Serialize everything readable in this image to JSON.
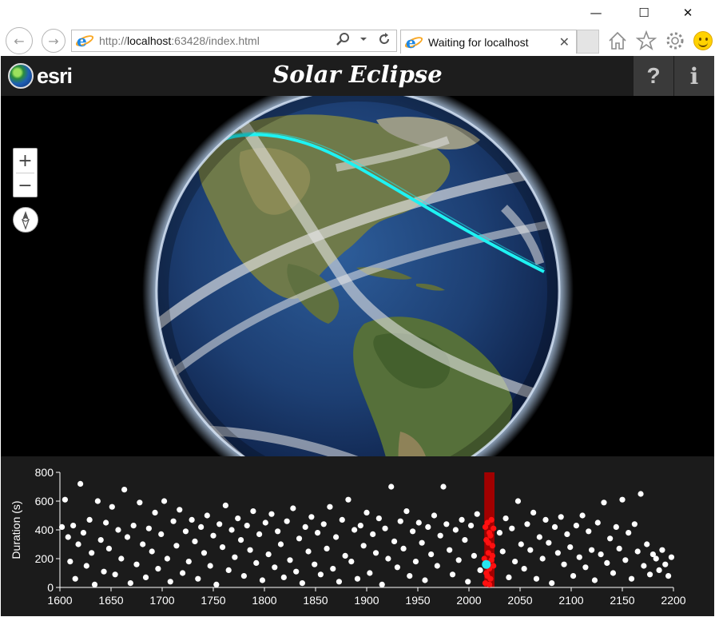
{
  "window": {
    "minimize_glyph": "—",
    "maximize_glyph": "☐",
    "close_glyph": "✕"
  },
  "browser": {
    "url_prefix": "http://",
    "url_host": "localhost",
    "url_rest": ":63428/index.html",
    "tab_label": "Waiting for localhost",
    "tab_close": "✕",
    "back_glyph": "←",
    "forward_glyph": "→",
    "icons": [
      "back-icon",
      "forward-icon",
      "ie-icon",
      "search-icon",
      "dropdown-icon",
      "refresh-icon",
      "home-icon",
      "favorites-star-icon",
      "settings-gear-icon",
      "smiley-feedback-icon"
    ]
  },
  "app": {
    "logo_text": "esri",
    "title": "Solar Eclipse",
    "help_label": "?",
    "info_label": "i",
    "zoom_in": "+",
    "zoom_out": "−"
  },
  "colors": {
    "header_bg": "#1d1d1d",
    "chart_bg": "#1b1b1b",
    "eclipse_path": "#1ef2f2",
    "selected_band": "#a10000",
    "highlight_points": "#ff1010",
    "points": "#ffffff",
    "selected_point": "#27e6f0"
  },
  "chart_data": {
    "type": "scatter",
    "xlabel": "",
    "ylabel": "Duration (s)",
    "xlim": [
      1600,
      2200
    ],
    "ylim": [
      0,
      800
    ],
    "x_ticks": [
      1600,
      1650,
      1700,
      1750,
      1800,
      1850,
      1900,
      1950,
      2000,
      2050,
      2100,
      2150,
      2200
    ],
    "y_ticks": [
      0,
      200,
      400,
      600,
      800
    ],
    "selected_band": [
      2015,
      2025
    ],
    "selected_point": {
      "x": 2017,
      "y": 160
    },
    "highlighted_points": [
      {
        "x": 2016,
        "y": 30
      },
      {
        "x": 2018,
        "y": 80
      },
      {
        "x": 2020,
        "y": 130
      },
      {
        "x": 2022,
        "y": 190
      },
      {
        "x": 2019,
        "y": 240
      },
      {
        "x": 2023,
        "y": 290
      },
      {
        "x": 2017,
        "y": 330
      },
      {
        "x": 2021,
        "y": 360
      },
      {
        "x": 2024,
        "y": 410
      },
      {
        "x": 2018,
        "y": 450
      },
      {
        "x": 2022,
        "y": 470
      },
      {
        "x": 2016,
        "y": 420
      },
      {
        "x": 2020,
        "y": 380
      },
      {
        "x": 2019,
        "y": 310
      },
      {
        "x": 2023,
        "y": 220
      },
      {
        "x": 2017,
        "y": 100
      },
      {
        "x": 2021,
        "y": 60
      },
      {
        "x": 2024,
        "y": 150
      },
      {
        "x": 2015,
        "y": 200
      },
      {
        "x": 2020,
        "y": 20
      }
    ],
    "points": [
      {
        "x": 1602,
        "y": 420
      },
      {
        "x": 1605,
        "y": 610
      },
      {
        "x": 1608,
        "y": 350
      },
      {
        "x": 1610,
        "y": 180
      },
      {
        "x": 1613,
        "y": 430
      },
      {
        "x": 1615,
        "y": 60
      },
      {
        "x": 1618,
        "y": 300
      },
      {
        "x": 1620,
        "y": 720
      },
      {
        "x": 1623,
        "y": 380
      },
      {
        "x": 1626,
        "y": 150
      },
      {
        "x": 1629,
        "y": 470
      },
      {
        "x": 1631,
        "y": 240
      },
      {
        "x": 1634,
        "y": 20
      },
      {
        "x": 1637,
        "y": 600
      },
      {
        "x": 1640,
        "y": 330
      },
      {
        "x": 1643,
        "y": 110
      },
      {
        "x": 1645,
        "y": 450
      },
      {
        "x": 1648,
        "y": 270
      },
      {
        "x": 1651,
        "y": 560
      },
      {
        "x": 1654,
        "y": 90
      },
      {
        "x": 1657,
        "y": 400
      },
      {
        "x": 1660,
        "y": 200
      },
      {
        "x": 1663,
        "y": 680
      },
      {
        "x": 1666,
        "y": 350
      },
      {
        "x": 1669,
        "y": 30
      },
      {
        "x": 1672,
        "y": 430
      },
      {
        "x": 1675,
        "y": 160
      },
      {
        "x": 1678,
        "y": 590
      },
      {
        "x": 1681,
        "y": 300
      },
      {
        "x": 1684,
        "y": 70
      },
      {
        "x": 1687,
        "y": 410
      },
      {
        "x": 1690,
        "y": 250
      },
      {
        "x": 1693,
        "y": 520
      },
      {
        "x": 1696,
        "y": 130
      },
      {
        "x": 1699,
        "y": 370
      },
      {
        "x": 1702,
        "y": 600
      },
      {
        "x": 1705,
        "y": 200
      },
      {
        "x": 1708,
        "y": 40
      },
      {
        "x": 1711,
        "y": 460
      },
      {
        "x": 1714,
        "y": 290
      },
      {
        "x": 1717,
        "y": 540
      },
      {
        "x": 1720,
        "y": 100
      },
      {
        "x": 1723,
        "y": 390
      },
      {
        "x": 1726,
        "y": 180
      },
      {
        "x": 1729,
        "y": 470
      },
      {
        "x": 1732,
        "y": 320
      },
      {
        "x": 1735,
        "y": 60
      },
      {
        "x": 1738,
        "y": 420
      },
      {
        "x": 1741,
        "y": 240
      },
      {
        "x": 1744,
        "y": 500
      },
      {
        "x": 1747,
        "y": 150
      },
      {
        "x": 1750,
        "y": 360
      },
      {
        "x": 1753,
        "y": 20
      },
      {
        "x": 1756,
        "y": 440
      },
      {
        "x": 1759,
        "y": 280
      },
      {
        "x": 1762,
        "y": 570
      },
      {
        "x": 1765,
        "y": 120
      },
      {
        "x": 1768,
        "y": 400
      },
      {
        "x": 1771,
        "y": 210
      },
      {
        "x": 1774,
        "y": 480
      },
      {
        "x": 1777,
        "y": 330
      },
      {
        "x": 1780,
        "y": 80
      },
      {
        "x": 1783,
        "y": 430
      },
      {
        "x": 1786,
        "y": 260
      },
      {
        "x": 1789,
        "y": 530
      },
      {
        "x": 1792,
        "y": 170
      },
      {
        "x": 1795,
        "y": 370
      },
      {
        "x": 1798,
        "y": 50
      },
      {
        "x": 1801,
        "y": 450
      },
      {
        "x": 1804,
        "y": 230
      },
      {
        "x": 1807,
        "y": 510
      },
      {
        "x": 1810,
        "y": 140
      },
      {
        "x": 1813,
        "y": 390
      },
      {
        "x": 1816,
        "y": 300
      },
      {
        "x": 1819,
        "y": 70
      },
      {
        "x": 1822,
        "y": 460
      },
      {
        "x": 1825,
        "y": 190
      },
      {
        "x": 1828,
        "y": 550
      },
      {
        "x": 1831,
        "y": 110
      },
      {
        "x": 1834,
        "y": 340
      },
      {
        "x": 1837,
        "y": 30
      },
      {
        "x": 1840,
        "y": 420
      },
      {
        "x": 1843,
        "y": 250
      },
      {
        "x": 1846,
        "y": 490
      },
      {
        "x": 1849,
        "y": 160
      },
      {
        "x": 1852,
        "y": 380
      },
      {
        "x": 1855,
        "y": 90
      },
      {
        "x": 1858,
        "y": 440
      },
      {
        "x": 1861,
        "y": 270
      },
      {
        "x": 1864,
        "y": 560
      },
      {
        "x": 1867,
        "y": 130
      },
      {
        "x": 1870,
        "y": 350
      },
      {
        "x": 1873,
        "y": 40
      },
      {
        "x": 1876,
        "y": 470
      },
      {
        "x": 1879,
        "y": 220
      },
      {
        "x": 1882,
        "y": 610
      },
      {
        "x": 1885,
        "y": 180
      },
      {
        "x": 1888,
        "y": 400
      },
      {
        "x": 1891,
        "y": 60
      },
      {
        "x": 1894,
        "y": 430
      },
      {
        "x": 1897,
        "y": 290
      },
      {
        "x": 1900,
        "y": 520
      },
      {
        "x": 1903,
        "y": 100
      },
      {
        "x": 1906,
        "y": 370
      },
      {
        "x": 1909,
        "y": 240
      },
      {
        "x": 1912,
        "y": 480
      },
      {
        "x": 1915,
        "y": 20
      },
      {
        "x": 1918,
        "y": 410
      },
      {
        "x": 1921,
        "y": 200
      },
      {
        "x": 1924,
        "y": 700
      },
      {
        "x": 1927,
        "y": 320
      },
      {
        "x": 1930,
        "y": 140
      },
      {
        "x": 1933,
        "y": 460
      },
      {
        "x": 1936,
        "y": 270
      },
      {
        "x": 1939,
        "y": 530
      },
      {
        "x": 1942,
        "y": 80
      },
      {
        "x": 1945,
        "y": 390
      },
      {
        "x": 1948,
        "y": 180
      },
      {
        "x": 1951,
        "y": 450
      },
      {
        "x": 1954,
        "y": 310
      },
      {
        "x": 1957,
        "y": 50
      },
      {
        "x": 1960,
        "y": 420
      },
      {
        "x": 1963,
        "y": 230
      },
      {
        "x": 1966,
        "y": 500
      },
      {
        "x": 1969,
        "y": 150
      },
      {
        "x": 1972,
        "y": 360
      },
      {
        "x": 1975,
        "y": 700
      },
      {
        "x": 1978,
        "y": 440
      },
      {
        "x": 1981,
        "y": 260
      },
      {
        "x": 1984,
        "y": 90
      },
      {
        "x": 1987,
        "y": 400
      },
      {
        "x": 1990,
        "y": 190
      },
      {
        "x": 1993,
        "y": 470
      },
      {
        "x": 1996,
        "y": 330
      },
      {
        "x": 1999,
        "y": 40
      },
      {
        "x": 2002,
        "y": 430
      },
      {
        "x": 2005,
        "y": 220
      },
      {
        "x": 2008,
        "y": 510
      },
      {
        "x": 2011,
        "y": 120
      },
      {
        "x": 2030,
        "y": 380
      },
      {
        "x": 2033,
        "y": 250
      },
      {
        "x": 2036,
        "y": 480
      },
      {
        "x": 2039,
        "y": 70
      },
      {
        "x": 2042,
        "y": 410
      },
      {
        "x": 2045,
        "y": 180
      },
      {
        "x": 2048,
        "y": 600
      },
      {
        "x": 2051,
        "y": 300
      },
      {
        "x": 2054,
        "y": 130
      },
      {
        "x": 2057,
        "y": 440
      },
      {
        "x": 2060,
        "y": 260
      },
      {
        "x": 2063,
        "y": 520
      },
      {
        "x": 2066,
        "y": 60
      },
      {
        "x": 2069,
        "y": 350
      },
      {
        "x": 2072,
        "y": 200
      },
      {
        "x": 2075,
        "y": 470
      },
      {
        "x": 2078,
        "y": 310
      },
      {
        "x": 2081,
        "y": 30
      },
      {
        "x": 2084,
        "y": 420
      },
      {
        "x": 2087,
        "y": 240
      },
      {
        "x": 2090,
        "y": 490
      },
      {
        "x": 2093,
        "y": 160
      },
      {
        "x": 2096,
        "y": 370
      },
      {
        "x": 2099,
        "y": 280
      },
      {
        "x": 2102,
        "y": 80
      },
      {
        "x": 2105,
        "y": 430
      },
      {
        "x": 2108,
        "y": 210
      },
      {
        "x": 2111,
        "y": 500
      },
      {
        "x": 2114,
        "y": 140
      },
      {
        "x": 2117,
        "y": 390
      },
      {
        "x": 2120,
        "y": 260
      },
      {
        "x": 2123,
        "y": 50
      },
      {
        "x": 2126,
        "y": 450
      },
      {
        "x": 2129,
        "y": 230
      },
      {
        "x": 2132,
        "y": 590
      },
      {
        "x": 2135,
        "y": 170
      },
      {
        "x": 2138,
        "y": 340
      },
      {
        "x": 2141,
        "y": 100
      },
      {
        "x": 2144,
        "y": 420
      },
      {
        "x": 2147,
        "y": 270
      },
      {
        "x": 2150,
        "y": 610
      },
      {
        "x": 2153,
        "y": 190
      },
      {
        "x": 2156,
        "y": 380
      },
      {
        "x": 2159,
        "y": 60
      },
      {
        "x": 2162,
        "y": 440
      },
      {
        "x": 2165,
        "y": 250
      },
      {
        "x": 2168,
        "y": 650
      },
      {
        "x": 2171,
        "y": 150
      },
      {
        "x": 2174,
        "y": 300
      },
      {
        "x": 2177,
        "y": 90
      },
      {
        "x": 2180,
        "y": 230
      },
      {
        "x": 2183,
        "y": 200
      },
      {
        "x": 2186,
        "y": 120
      },
      {
        "x": 2189,
        "y": 260
      },
      {
        "x": 2192,
        "y": 160
      },
      {
        "x": 2195,
        "y": 80
      },
      {
        "x": 2198,
        "y": 210
      }
    ]
  }
}
